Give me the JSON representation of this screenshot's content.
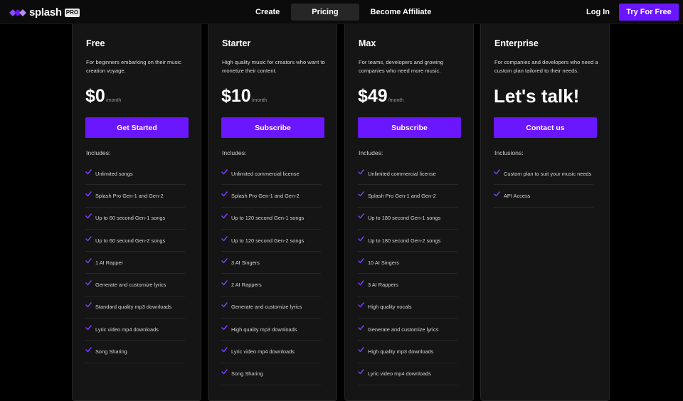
{
  "brand": {
    "name": "splash",
    "badge": "PRO",
    "accent": "#6a16ff"
  },
  "nav": {
    "links": [
      {
        "label": "Create"
      },
      {
        "label": "Pricing",
        "active": true
      },
      {
        "label": "Become Affiliate"
      }
    ],
    "login": "Log In",
    "cta": "Try For Free"
  },
  "plans": [
    {
      "name": "Free",
      "description": "For beginners embarking on their music creation voyage.",
      "price": "$0",
      "period": "/month",
      "cta": "Get Started",
      "includes_label": "Includes:",
      "features": [
        "Unlimited songs",
        "Splash Pro Gen-1 and Gen-2",
        "Up to 60 second Gen-1 songs",
        "Up to 60 second Gen-2 songs",
        "1 AI Rapper",
        "Generate and customize lyrics",
        "Standard quality mp3 downloads",
        "Lyric video mp4 downloads",
        "Song Sharing"
      ]
    },
    {
      "name": "Starter",
      "description": "High quality music for creators who want to monetize their content.",
      "price": "$10",
      "period": "/month",
      "cta": "Subscribe",
      "includes_label": "Includes:",
      "features": [
        "Unlimited commercial license",
        "Splash Pro Gen-1 and Gen-2",
        "Up to 120 second Gen-1 songs",
        "Up to 120 second Gen-2 songs",
        "3 AI Singers",
        "2 AI Rappers",
        "Generate and customize lyrics",
        "High quality mp3 downloads",
        "Lyric video mp4 downloads",
        "Song Sharing"
      ]
    },
    {
      "name": "Max",
      "description": "For teams, developers and growing companies who need more music.",
      "price": "$49",
      "period": "/month",
      "cta": "Subscribe",
      "includes_label": "Includes:",
      "features": [
        "Unlimited commercial license",
        "Splash Pro Gen-1 and Gen-2",
        "Up to 180 second Gen-1 songs",
        "Up to 180 second Gen-2 songs",
        "10 AI Singers",
        "3 AI Rappers",
        "High quality vocals",
        "Generate and customize lyrics",
        "High quality mp3 downloads",
        "Lyric video mp4 downloads"
      ]
    },
    {
      "name": "Enterprise",
      "description": "For companies and developers who need a custom plan tailored to their needs.",
      "price": "Let's talk!",
      "cta": "Contact us",
      "includes_label": "Inclusions:",
      "features": [
        "Custom plan to suit your music needs",
        "API Access"
      ]
    }
  ]
}
